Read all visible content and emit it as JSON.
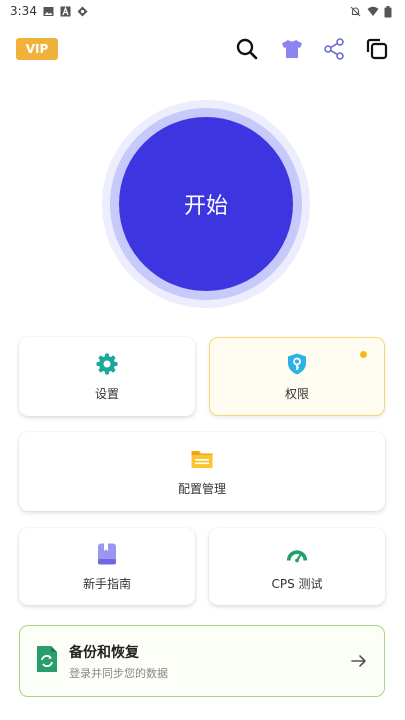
{
  "status_bar": {
    "time": "3:34",
    "left_icons": [
      "image-icon",
      "a-box-icon",
      "location-diamond-icon"
    ],
    "right_icons": [
      "bell-off-icon",
      "wifi-icon",
      "battery-icon"
    ]
  },
  "top_bar": {
    "vip_label": "VIP",
    "icons": [
      "search-icon",
      "tshirt-icon",
      "share-icon",
      "copy-icon"
    ]
  },
  "start_button": {
    "label": "开始"
  },
  "cards": {
    "settings": {
      "label": "设置",
      "icon": "gear-icon"
    },
    "permissions": {
      "label": "权限",
      "icon": "shield-key-icon",
      "has_notification": true
    },
    "config": {
      "label": "配置管理",
      "icon": "folder-icon"
    },
    "guide": {
      "label": "新手指南",
      "icon": "book-icon"
    },
    "cps": {
      "label": "CPS 测试",
      "icon": "gauge-icon"
    }
  },
  "backup": {
    "title": "备份和恢复",
    "subtitle": "登录并同步您的数据",
    "icon": "backup-sync-icon",
    "arrow_icon": "arrow-right-icon"
  },
  "colors": {
    "accent": "#3c35e0",
    "vip": "#f0b23a",
    "notification": "#f5b81c",
    "backup_border": "#a9d483"
  }
}
